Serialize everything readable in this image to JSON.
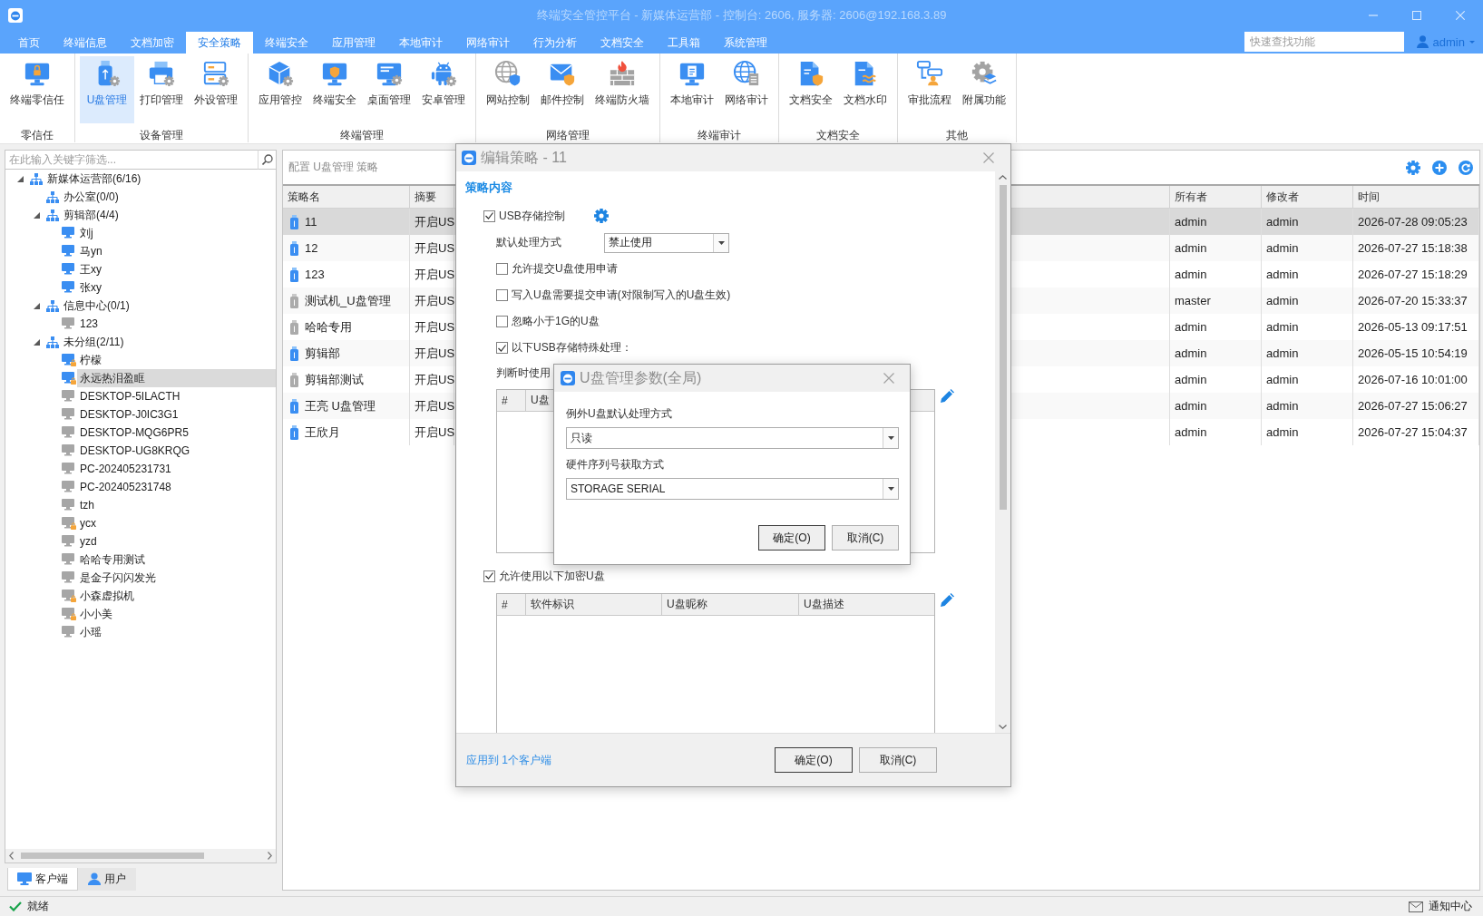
{
  "window": {
    "title": "终端安全管控平台 - 新媒体运营部 - 控制台: 2606, 服务器: 2606@192.168.3.89"
  },
  "menu": [
    {
      "label": "首页",
      "selected": false
    },
    {
      "label": "终端信息",
      "selected": false
    },
    {
      "label": "文档加密",
      "selected": false
    },
    {
      "label": "安全策略",
      "selected": true
    },
    {
      "label": "终端安全",
      "selected": false
    },
    {
      "label": "应用管理",
      "selected": false
    },
    {
      "label": "本地审计",
      "selected": false
    },
    {
      "label": "网络审计",
      "selected": false
    },
    {
      "label": "行为分析",
      "selected": false
    },
    {
      "label": "文档安全",
      "selected": false
    },
    {
      "label": "工具箱",
      "selected": false
    },
    {
      "label": "系统管理",
      "selected": false
    }
  ],
  "quick_search": {
    "placeholder": "快速查找功能"
  },
  "user": {
    "name": "admin"
  },
  "ribbon": {
    "groups": [
      {
        "label": "零信任",
        "items": [
          {
            "label": "终端零信任",
            "kind": "zerotrust",
            "selected": false
          }
        ]
      },
      {
        "label": "设备管理",
        "items": [
          {
            "label": "U盘管理",
            "kind": "usb",
            "selected": true
          },
          {
            "label": "打印管理",
            "kind": "printer",
            "selected": false
          },
          {
            "label": "外设管理",
            "kind": "peripheral",
            "selected": false
          }
        ]
      },
      {
        "label": "终端管理",
        "items": [
          {
            "label": "应用管控",
            "kind": "app",
            "selected": false
          },
          {
            "label": "终端安全",
            "kind": "shield",
            "selected": false
          },
          {
            "label": "桌面管理",
            "kind": "desktop",
            "selected": false
          },
          {
            "label": "安卓管理",
            "kind": "android",
            "selected": false
          }
        ]
      },
      {
        "label": "网络管理",
        "items": [
          {
            "label": "网站控制",
            "kind": "web",
            "selected": false
          },
          {
            "label": "邮件控制",
            "kind": "mail",
            "selected": false
          },
          {
            "label": "终端防火墙",
            "kind": "firewall",
            "selected": false
          }
        ]
      },
      {
        "label": "终端审计",
        "items": [
          {
            "label": "本地审计",
            "kind": "audit",
            "selected": false
          },
          {
            "label": "网络审计",
            "kind": "netaudit",
            "selected": false
          }
        ]
      },
      {
        "label": "文档安全",
        "items": [
          {
            "label": "文档安全",
            "kind": "doc",
            "selected": false
          },
          {
            "label": "文档水印",
            "kind": "watermark",
            "selected": false
          }
        ]
      },
      {
        "label": "其他",
        "items": [
          {
            "label": "审批流程",
            "kind": "workflow",
            "selected": false
          },
          {
            "label": "附属功能",
            "kind": "addon",
            "selected": false
          }
        ]
      }
    ]
  },
  "sidebar": {
    "search": {
      "placeholder": "在此输入关键字筛选..."
    },
    "tree": [
      {
        "label": "新媒体运营部(6/16)",
        "kind": "group",
        "expanded": true,
        "selected": false,
        "children": [
          {
            "label": "办公室(0/0)",
            "kind": "group",
            "selected": false
          },
          {
            "label": "剪辑部(4/4)",
            "kind": "group",
            "expanded": true,
            "selected": false,
            "children": [
              {
                "label": "刘j",
                "kind": "client",
                "online": true,
                "locked": false,
                "selected": false
              },
              {
                "label": "马yn",
                "kind": "client",
                "online": true,
                "locked": false,
                "selected": false
              },
              {
                "label": "王xy",
                "kind": "client",
                "online": true,
                "locked": false,
                "selected": false
              },
              {
                "label": "张xy",
                "kind": "client",
                "online": true,
                "locked": false,
                "selected": false
              }
            ]
          },
          {
            "label": "信息中心(0/1)",
            "kind": "group",
            "expanded": true,
            "selected": false,
            "children": [
              {
                "label": "123",
                "kind": "client",
                "online": false,
                "locked": false,
                "selected": false
              }
            ]
          },
          {
            "label": "未分组(2/11)",
            "kind": "group",
            "expanded": true,
            "selected": false,
            "children": [
              {
                "label": "柠檬",
                "kind": "client",
                "online": true,
                "locked": true,
                "selected": false
              },
              {
                "label": "永远热泪盈眶",
                "kind": "client",
                "online": true,
                "locked": true,
                "selected": true
              },
              {
                "label": "DESKTOP-5ILACTH",
                "kind": "client",
                "online": false,
                "locked": false,
                "selected": false
              },
              {
                "label": "DESKTOP-J0IC3G1",
                "kind": "client",
                "online": false,
                "locked": false,
                "selected": false
              },
              {
                "label": "DESKTOP-MQG6PR5",
                "kind": "client",
                "online": false,
                "locked": false,
                "selected": false
              },
              {
                "label": "DESKTOP-UG8KRQG",
                "kind": "client",
                "online": false,
                "locked": false,
                "selected": false
              },
              {
                "label": "PC-202405231731",
                "kind": "client",
                "online": false,
                "locked": false,
                "selected": false
              },
              {
                "label": "PC-202405231748",
                "kind": "client",
                "online": false,
                "locked": false,
                "selected": false
              },
              {
                "label": "tzh",
                "kind": "client",
                "online": false,
                "locked": false,
                "selected": false
              },
              {
                "label": "ycx",
                "kind": "client",
                "online": false,
                "locked": true,
                "selected": false
              },
              {
                "label": "yzd",
                "kind": "client",
                "online": false,
                "locked": false,
                "selected": false
              },
              {
                "label": "哈哈专用测试",
                "kind": "client",
                "online": false,
                "locked": false,
                "selected": false
              },
              {
                "label": "是金子闪闪发光",
                "kind": "client",
                "online": false,
                "locked": false,
                "selected": false
              },
              {
                "label": "小森虚拟机",
                "kind": "client",
                "online": false,
                "locked": true,
                "selected": false
              },
              {
                "label": "小小美",
                "kind": "client",
                "online": false,
                "locked": true,
                "selected": false
              },
              {
                "label": "小瑶",
                "kind": "client",
                "online": false,
                "locked": false,
                "selected": false
              }
            ]
          }
        ]
      }
    ],
    "tabs": [
      {
        "label": "客户端",
        "kind": "client",
        "selected": true
      },
      {
        "label": "用户",
        "kind": "user",
        "selected": false
      }
    ]
  },
  "main": {
    "title": "配置 U盘管理 策略",
    "table": {
      "columns": [
        "策略名",
        "摘要",
        "所有者",
        "修改者",
        "时间"
      ],
      "rows": [
        {
          "name": "11",
          "enabled": true,
          "summary": "开启US",
          "owner": "admin",
          "modifier": "admin",
          "time": "2026-07-28 09:05:23",
          "selected": true
        },
        {
          "name": "12",
          "enabled": true,
          "summary": "开启US",
          "owner": "admin",
          "modifier": "admin",
          "time": "2026-07-27 15:18:38",
          "selected": false
        },
        {
          "name": "123",
          "enabled": true,
          "summary": "开启US",
          "owner": "admin",
          "modifier": "admin",
          "time": "2026-07-27 15:18:29",
          "selected": false
        },
        {
          "name": "测试机_U盘管理",
          "enabled": false,
          "summary": "开启US",
          "owner": "master",
          "modifier": "admin",
          "time": "2026-07-20 15:33:37",
          "selected": false
        },
        {
          "name": "哈哈专用",
          "enabled": false,
          "summary": "开启US",
          "owner": "admin",
          "modifier": "admin",
          "time": "2026-05-13 09:17:51",
          "selected": false
        },
        {
          "name": "剪辑部",
          "enabled": true,
          "summary": "开启US",
          "owner": "admin",
          "modifier": "admin",
          "time": "2026-05-15 10:54:19",
          "selected": false
        },
        {
          "name": "剪辑部测试",
          "enabled": false,
          "summary": "开启US",
          "owner": "admin",
          "modifier": "admin",
          "time": "2026-07-16 10:01:00",
          "selected": false
        },
        {
          "name": "王亮 U盘管理",
          "enabled": true,
          "summary": "开启US",
          "owner": "admin",
          "modifier": "admin",
          "time": "2026-07-27 15:06:27",
          "selected": false
        },
        {
          "name": "王欣月",
          "enabled": true,
          "summary": "开启US",
          "owner": "admin",
          "modifier": "admin",
          "time": "2026-07-27 15:04:37",
          "selected": false
        }
      ]
    }
  },
  "edit_dialog": {
    "title": "编辑策略 - 11",
    "section": "策略内容",
    "usb_control": {
      "label": "USB存储控制",
      "checked": true
    },
    "default_action": {
      "label": "默认处理方式",
      "value": "禁止使用"
    },
    "options": [
      {
        "label": "允许提交U盘使用申请",
        "checked": false
      },
      {
        "label": "写入U盘需要提交申请(对限制写入的U盘生效)",
        "checked": false
      },
      {
        "label": "忽略小于1G的U盘",
        "checked": false
      },
      {
        "label": "以下USB存储特殊处理：",
        "checked": true
      }
    ],
    "judge_label": "判断时使用",
    "special_table": {
      "columns": [
        "#",
        "U盘"
      ]
    },
    "encrypted": {
      "label": "允许使用以下加密U盘",
      "checked": true
    },
    "encrypted_table": {
      "columns": [
        "#",
        "软件标识",
        "U盘昵称",
        "U盘描述"
      ]
    },
    "apply_link": "应用到 1个客户端",
    "buttons": [
      {
        "label": "确定(O)",
        "default": true
      },
      {
        "label": "取消(C)",
        "default": false
      }
    ]
  },
  "param_dialog": {
    "title": "U盘管理参数(全局)",
    "fields": [
      {
        "label": "例外U盘默认处理方式",
        "value": "只读"
      },
      {
        "label": "硬件序列号获取方式",
        "value": "STORAGE SERIAL"
      }
    ],
    "buttons": [
      {
        "label": "确定(O)",
        "default": true
      },
      {
        "label": "取消(C)",
        "default": false
      }
    ]
  },
  "status_bar": {
    "status": "就绪",
    "notifications": "通知中心"
  }
}
